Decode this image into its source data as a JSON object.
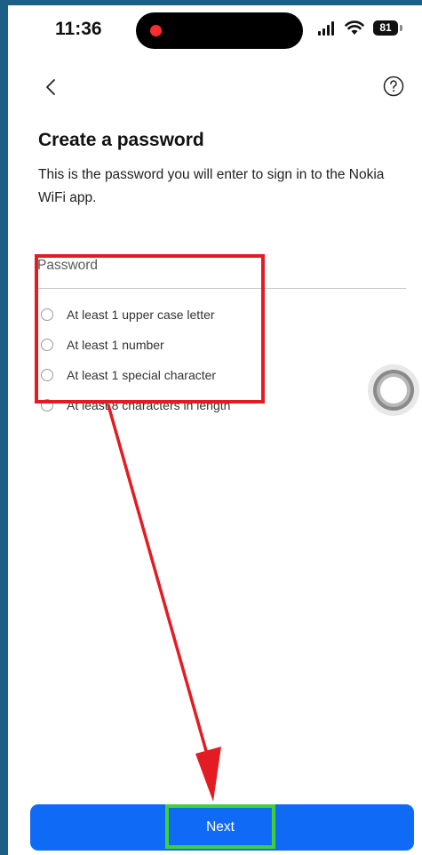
{
  "status_bar": {
    "time": "11:36",
    "battery": "81"
  },
  "header": {
    "back_icon": "chevron-left-icon",
    "help_icon": "question-circle-icon"
  },
  "title": "Create a password",
  "description": "This is the password you will enter to sign in to the Nokia WiFi app.",
  "password_field": {
    "placeholder": "Password",
    "value": ""
  },
  "requirements": [
    {
      "label": "At least 1 upper case letter",
      "met": false
    },
    {
      "label": "At least 1 number",
      "met": false
    },
    {
      "label": "At least 1 special character",
      "met": false
    },
    {
      "label": "At least 8 characters in length",
      "met": false
    }
  ],
  "next_button": {
    "label": "Next"
  },
  "colors": {
    "primary_button": "#0f6bf5",
    "annotation_red": "#e31c23",
    "annotation_green": "#3fd13b",
    "frame": "#1c5f86"
  }
}
